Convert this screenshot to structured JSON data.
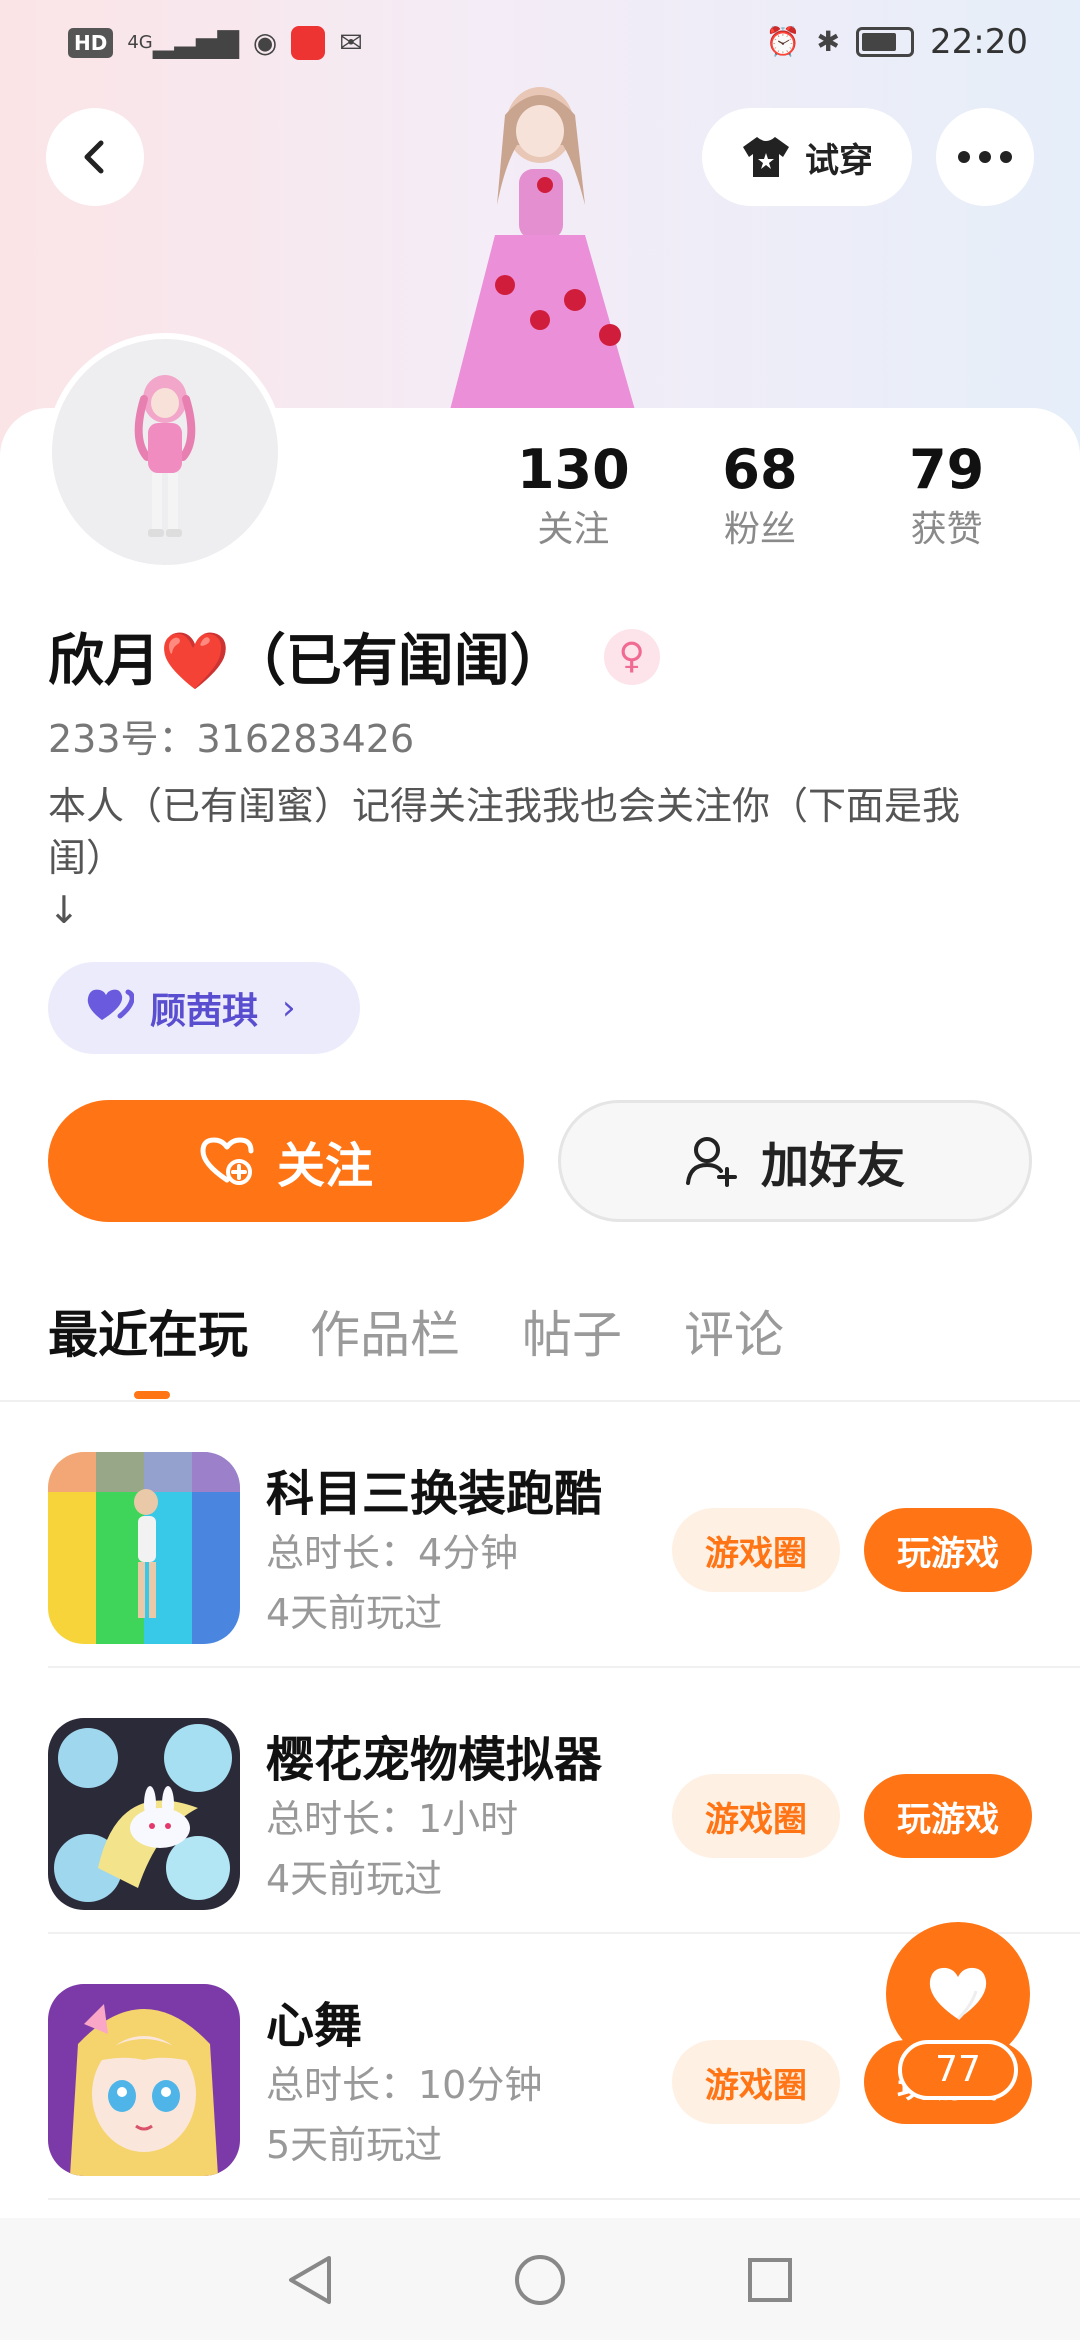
{
  "status_bar": {
    "hd": "HD",
    "network": "4G",
    "time": "22:20"
  },
  "header": {
    "tryon_label": "试穿"
  },
  "stats": [
    {
      "value": "130",
      "label": "关注"
    },
    {
      "value": "68",
      "label": "粉丝"
    },
    {
      "value": "79",
      "label": "获赞"
    }
  ],
  "profile": {
    "nickname": "欣月❤️（已有闺闺）",
    "gender_symbol": "♀",
    "uid": "233号：316283426",
    "bio": "本人（已有闺蜜）记得关注我我也会关注你（下面是我\n闺）\n↓",
    "bestie_name": "顾茜琪"
  },
  "actions": {
    "follow_label": "关注",
    "add_friend_label": "加好友"
  },
  "tabs": [
    {
      "label": "最近在玩",
      "active": true
    },
    {
      "label": "作品栏",
      "active": false
    },
    {
      "label": "帖子",
      "active": false
    },
    {
      "label": "评论",
      "active": false
    }
  ],
  "games": [
    {
      "title": "科目三换装跑酷",
      "duration": "总时长：4分钟",
      "last_played": "4天前玩过",
      "circle_label": "游戏圈",
      "play_label": "玩游戏"
    },
    {
      "title": "樱花宠物模拟器",
      "duration": "总时长：1小时",
      "last_played": "4天前玩过",
      "circle_label": "游戏圈",
      "play_label": "玩游戏"
    },
    {
      "title": "心舞",
      "duration": "总时长：10分钟",
      "last_played": "5天前玩过",
      "circle_label": "游戏圈",
      "play_label": "玩游戏"
    }
  ],
  "floating_like": {
    "count": "77"
  },
  "icons": {
    "back": "back-arrow-icon",
    "shirt": "shirt-icon",
    "more": "more-dots-icon",
    "heart_plus": "heart-plus-icon",
    "user_plus": "user-plus-icon",
    "bestie_heart": "double-heart-icon",
    "like": "heart-icon"
  },
  "colors": {
    "accent": "#ff7414",
    "accent_light": "#fff0e4",
    "bestie_bg": "#ecebfb",
    "bestie_text": "#5a4ed0"
  }
}
